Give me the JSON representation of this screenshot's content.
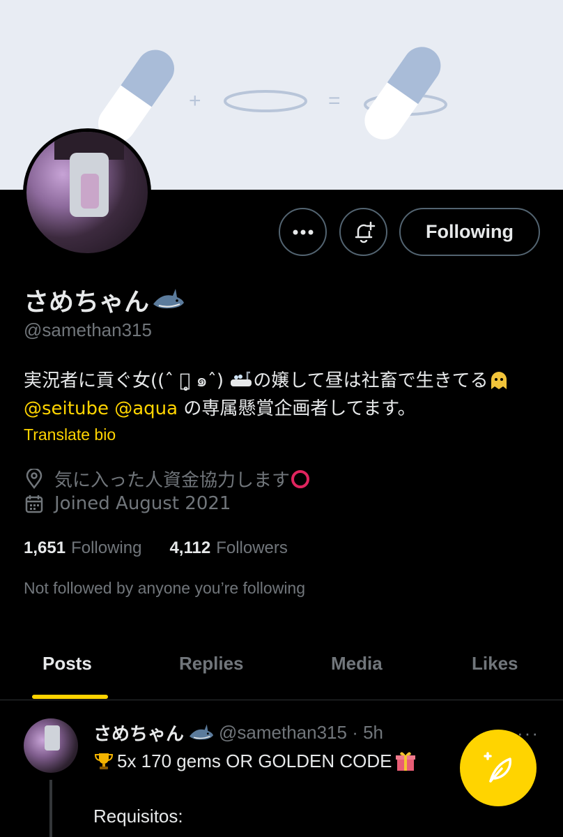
{
  "profile": {
    "name": "さめちゃん",
    "handle": "@samethan315",
    "bio_part1": "実況者に貢ぐ女((ˆ ๑̥̥̥ ๑ˆ) ",
    "bio_part2": "の嬢して昼は社畜で生きてる",
    "mention1": "@seitube",
    "mention2": "@aqua",
    "bio_part3": " の専属懸賞企画者してます。",
    "translate_label": "Translate bio",
    "location": "気に入った人資金協力します",
    "joined": "Joined August 2021",
    "following_count": "1,651",
    "following_label": "Following",
    "followers_count": "4,112",
    "followers_label": "Followers",
    "not_followed_text": "Not followed by anyone you’re following"
  },
  "actions": {
    "following_button": "Following"
  },
  "tabs": [
    {
      "label": "Posts"
    },
    {
      "label": "Replies"
    },
    {
      "label": "Media"
    },
    {
      "label": "Likes"
    }
  ],
  "post": {
    "name": "さめちゃん",
    "meta": "@samethan315 · 5h",
    "more": "···",
    "line1": "5x 170 gems OR GOLDEN CODE",
    "line2": "Requisitos:"
  },
  "colors": {
    "accent": "#ffd400",
    "background": "#000000",
    "muted": "#71767b",
    "banner": "#e8ecf3"
  },
  "icons": [
    "more-icon",
    "bell-plus-icon",
    "shark-emoji-icon",
    "bathtub-emoji-icon",
    "ghost-emoji-icon",
    "location-pin-icon",
    "red-circle-icon",
    "calendar-icon",
    "trophy-emoji-icon",
    "gift-emoji-icon",
    "compose-feather-icon"
  ]
}
